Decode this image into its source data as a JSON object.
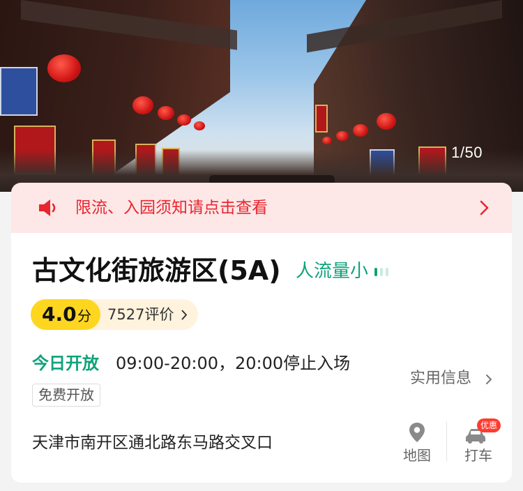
{
  "hero": {
    "photo_counter": "1/50"
  },
  "notice": {
    "icon": "speaker-icon",
    "text": "限流、入园须知请点击查看",
    "color": "#e8262f",
    "background": "#fde7e7"
  },
  "attraction": {
    "title": "古文化街旅游区(5A)",
    "crowd_level": "人流量小",
    "crowd_level_color": "#0fa27a"
  },
  "rating": {
    "score": "4.0",
    "score_unit": "分",
    "review_count": "7527评价",
    "accent": "#ffd61f"
  },
  "hours": {
    "label": "今日开放",
    "value": "09:00-20:00，20:00停止入场"
  },
  "tags": {
    "free": "免费开放"
  },
  "useful_info": {
    "label": "实用信息"
  },
  "address": {
    "text": "天津市南开区通北路东马路交叉口"
  },
  "actions": {
    "map": {
      "label": "地图",
      "icon": "map-pin-icon"
    },
    "taxi": {
      "label": "打车",
      "icon": "car-icon",
      "badge": "优惠"
    }
  }
}
